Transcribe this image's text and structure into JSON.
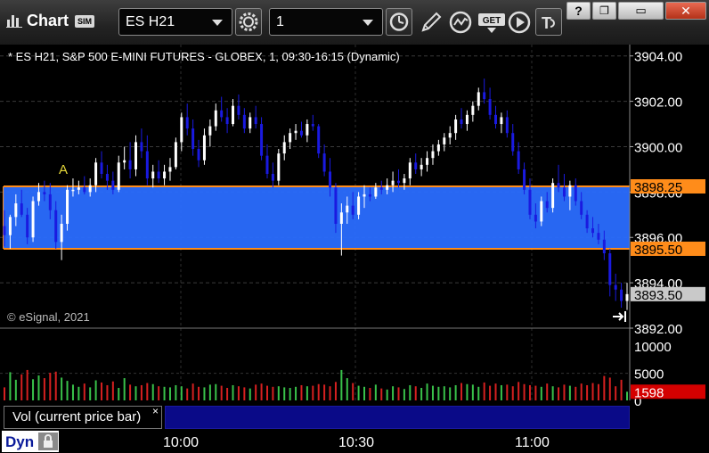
{
  "window": {
    "title": "Chart",
    "mode_badge": "SIM",
    "symbol": "ES H21",
    "interval": "1",
    "controls": {
      "help": "?",
      "restore": "❐",
      "minimize": "▭",
      "close": "✕"
    }
  },
  "toolbar_icons": [
    "settings-gear-icon",
    "clock-icon",
    "pencil-draw-icon",
    "study-wave-icon",
    "get-data-icon",
    "play-icon",
    "text-format-icon"
  ],
  "chart": {
    "title": "* ES H21, S&P 500 E-MINI FUTURES - GLOBEX, 1, 09:30-16:15 (Dynamic)",
    "copyright": "© eSignal, 2021",
    "marker_label": "A",
    "price_ticks": [
      "3904.00",
      "3902.00",
      "3900.00",
      "3898.00",
      "3896.00",
      "3894.00",
      "3892.00"
    ],
    "zone_upper": "3898.25",
    "zone_lower": "3895.50",
    "last_price": "3893.50",
    "volume_ticks": [
      "10000",
      "5000",
      "0"
    ],
    "volume_last": "1598",
    "volume_pane_label": "Vol (current price bar)",
    "volume_pane_close": "×",
    "time_labels": [
      "10:00",
      "10:30",
      "11:00"
    ],
    "status_label": "Dyn",
    "colors": {
      "up_bar": "#ffffff",
      "down_bar": "#1a1ae0",
      "zone_fill": "#2a6dff",
      "zone_line": "#ff8c1a",
      "vol_up": "#39c24a",
      "vol_down": "#d62020",
      "last_price_bg": "#c9c9c9",
      "volume_last_bg": "#d40000"
    }
  },
  "chart_data": {
    "type": "candlestick",
    "title": "* ES H21, S&P 500 E-MINI FUTURES - GLOBEX, 1, 09:30-16:15 (Dynamic)",
    "ylim": [
      3892,
      3904.5
    ],
    "zone": [
      3895.5,
      3898.25
    ],
    "last": 3893.5,
    "volume_ylim": [
      0,
      12000
    ],
    "volume_last": 1598,
    "bars": [
      [
        3896.5,
        3897.2,
        3895.6,
        3896.1
      ],
      [
        3896.1,
        3897.0,
        3895.5,
        3896.9
      ],
      [
        3896.9,
        3897.9,
        3896.5,
        3897.5
      ],
      [
        3897.5,
        3898.1,
        3896.9,
        3897.0
      ],
      [
        3897.0,
        3897.3,
        3895.7,
        3896.0
      ],
      [
        3896.0,
        3897.8,
        3895.8,
        3897.6
      ],
      [
        3897.6,
        3898.4,
        3897.4,
        3898.0
      ],
      [
        3898.0,
        3898.5,
        3897.6,
        3897.9
      ],
      [
        3897.9,
        3898.4,
        3896.8,
        3897.2
      ],
      [
        3897.2,
        3897.6,
        3895.5,
        3895.8
      ],
      [
        3895.8,
        3897.0,
        3895.0,
        3896.6
      ],
      [
        3896.6,
        3898.3,
        3896.3,
        3898.1
      ],
      [
        3898.1,
        3898.6,
        3897.8,
        3898.1
      ],
      [
        3898.1,
        3898.5,
        3897.9,
        3898.2
      ],
      [
        3898.2,
        3898.7,
        3897.9,
        3898.0
      ],
      [
        3898.0,
        3898.6,
        3897.8,
        3898.3
      ],
      [
        3898.3,
        3899.5,
        3898.0,
        3899.3
      ],
      [
        3899.3,
        3899.8,
        3898.6,
        3898.8
      ],
      [
        3898.8,
        3899.2,
        3898.1,
        3898.5
      ],
      [
        3898.5,
        3898.9,
        3897.9,
        3898.1
      ],
      [
        3898.1,
        3899.6,
        3898.0,
        3899.3
      ],
      [
        3899.3,
        3900.0,
        3899.0,
        3899.4
      ],
      [
        3899.4,
        3900.2,
        3898.6,
        3899.0
      ],
      [
        3899.0,
        3900.5,
        3898.7,
        3900.2
      ],
      [
        3900.2,
        3900.8,
        3899.5,
        3899.8
      ],
      [
        3899.8,
        3900.5,
        3898.3,
        3898.6
      ],
      [
        3898.6,
        3899.2,
        3898.2,
        3898.9
      ],
      [
        3898.9,
        3899.4,
        3898.4,
        3898.6
      ],
      [
        3898.6,
        3899.2,
        3898.3,
        3898.9
      ],
      [
        3898.9,
        3899.5,
        3898.5,
        3899.1
      ],
      [
        3899.1,
        3900.4,
        3899.0,
        3900.2
      ],
      [
        3900.2,
        3901.5,
        3899.8,
        3901.3
      ],
      [
        3901.3,
        3901.9,
        3900.5,
        3900.8
      ],
      [
        3900.8,
        3901.2,
        3899.6,
        3899.9
      ],
      [
        3899.9,
        3900.3,
        3899.1,
        3899.4
      ],
      [
        3899.4,
        3900.8,
        3899.2,
        3900.5
      ],
      [
        3900.5,
        3901.2,
        3900.0,
        3900.9
      ],
      [
        3900.9,
        3901.9,
        3900.7,
        3901.6
      ],
      [
        3901.6,
        3902.2,
        3901.1,
        3901.3
      ],
      [
        3901.3,
        3901.7,
        3900.6,
        3901.0
      ],
      [
        3901.0,
        3902.1,
        3900.9,
        3901.8
      ],
      [
        3901.8,
        3902.3,
        3901.2,
        3901.4
      ],
      [
        3901.4,
        3901.7,
        3900.6,
        3900.8
      ],
      [
        3900.8,
        3901.5,
        3900.6,
        3901.3
      ],
      [
        3901.3,
        3901.8,
        3900.8,
        3901.0
      ],
      [
        3901.0,
        3901.3,
        3899.4,
        3899.6
      ],
      [
        3899.6,
        3900.1,
        3898.6,
        3898.8
      ],
      [
        3898.8,
        3899.3,
        3898.2,
        3898.5
      ],
      [
        3898.5,
        3899.9,
        3898.3,
        3899.7
      ],
      [
        3899.7,
        3900.5,
        3899.4,
        3900.2
      ],
      [
        3900.2,
        3900.8,
        3899.9,
        3900.6
      ],
      [
        3900.6,
        3901.0,
        3900.3,
        3900.7
      ],
      [
        3900.7,
        3901.1,
        3900.4,
        3900.5
      ],
      [
        3900.5,
        3901.2,
        3900.2,
        3901.0
      ],
      [
        3901.0,
        3901.4,
        3900.7,
        3900.9
      ],
      [
        3900.9,
        3901.0,
        3899.5,
        3899.7
      ],
      [
        3899.7,
        3900.1,
        3898.7,
        3898.9
      ],
      [
        3898.9,
        3899.5,
        3897.8,
        3898.2
      ],
      [
        3898.2,
        3898.4,
        3896.2,
        3896.6
      ],
      [
        3896.6,
        3897.5,
        3895.2,
        3897.1
      ],
      [
        3897.1,
        3897.8,
        3896.6,
        3897.4
      ],
      [
        3897.4,
        3898.0,
        3896.8,
        3897.0
      ],
      [
        3897.0,
        3898.0,
        3896.8,
        3897.8
      ],
      [
        3897.8,
        3898.3,
        3897.3,
        3897.9
      ],
      [
        3897.9,
        3898.2,
        3897.6,
        3897.8
      ],
      [
        3897.8,
        3898.4,
        3897.7,
        3898.2
      ],
      [
        3898.2,
        3898.5,
        3897.9,
        3898.1
      ],
      [
        3898.1,
        3898.6,
        3897.9,
        3898.3
      ],
      [
        3898.3,
        3898.9,
        3898.0,
        3898.5
      ],
      [
        3898.5,
        3899.0,
        3898.2,
        3898.4
      ],
      [
        3898.4,
        3898.8,
        3898.1,
        3898.6
      ],
      [
        3898.6,
        3899.5,
        3898.3,
        3899.3
      ],
      [
        3899.3,
        3899.7,
        3898.8,
        3899.0
      ],
      [
        3899.0,
        3899.5,
        3898.7,
        3899.2
      ],
      [
        3899.2,
        3899.8,
        3898.9,
        3899.5
      ],
      [
        3899.5,
        3900.1,
        3899.2,
        3899.8
      ],
      [
        3899.8,
        3900.3,
        3899.6,
        3900.1
      ],
      [
        3900.1,
        3900.6,
        3899.8,
        3900.4
      ],
      [
        3900.4,
        3900.9,
        3900.1,
        3900.6
      ],
      [
        3900.6,
        3901.4,
        3900.3,
        3901.2
      ],
      [
        3901.2,
        3901.7,
        3900.8,
        3901.0
      ],
      [
        3901.0,
        3901.6,
        3900.7,
        3901.4
      ],
      [
        3901.4,
        3902.0,
        3901.1,
        3901.8
      ],
      [
        3901.8,
        3902.6,
        3901.6,
        3902.4
      ],
      [
        3902.4,
        3903.0,
        3901.9,
        3902.1
      ],
      [
        3902.1,
        3902.6,
        3901.2,
        3901.4
      ],
      [
        3901.4,
        3901.8,
        3900.8,
        3901.0
      ],
      [
        3901.0,
        3901.5,
        3900.6,
        3901.3
      ],
      [
        3901.3,
        3901.6,
        3900.4,
        3900.6
      ],
      [
        3900.6,
        3901.0,
        3899.6,
        3899.8
      ],
      [
        3899.8,
        3900.2,
        3898.8,
        3899.0
      ],
      [
        3899.0,
        3899.3,
        3897.9,
        3898.1
      ],
      [
        3898.1,
        3898.6,
        3896.8,
        3897.0
      ],
      [
        3897.0,
        3897.5,
        3896.4,
        3896.7
      ],
      [
        3896.7,
        3897.8,
        3896.5,
        3897.6
      ],
      [
        3897.6,
        3898.0,
        3897.1,
        3897.3
      ],
      [
        3897.3,
        3898.6,
        3897.1,
        3898.4
      ],
      [
        3898.4,
        3899.2,
        3898.0,
        3898.2
      ],
      [
        3898.2,
        3898.8,
        3897.6,
        3897.8
      ],
      [
        3897.8,
        3898.5,
        3897.2,
        3898.3
      ],
      [
        3898.3,
        3898.6,
        3897.4,
        3897.6
      ],
      [
        3897.6,
        3898.0,
        3896.8,
        3897.0
      ],
      [
        3897.0,
        3897.2,
        3896.2,
        3896.4
      ],
      [
        3896.4,
        3896.9,
        3896.0,
        3896.2
      ],
      [
        3896.2,
        3896.6,
        3895.7,
        3895.9
      ],
      [
        3895.9,
        3896.3,
        3895.0,
        3895.3
      ],
      [
        3895.3,
        3895.5,
        3893.4,
        3893.9
      ],
      [
        3893.9,
        3894.4,
        3893.2,
        3893.7
      ],
      [
        3893.7,
        3894.0,
        3892.9,
        3893.2
      ],
      [
        3893.2,
        3894.0,
        3892.8,
        3893.5
      ]
    ],
    "volume": [
      2400,
      5200,
      3800,
      4800,
      5600,
      3900,
      4600,
      4100,
      5100,
      5300,
      4200,
      3600,
      2900,
      2500,
      3100,
      2400,
      3700,
      3300,
      2800,
      3500,
      2300,
      4100,
      2900,
      2600,
      2800,
      3200,
      3000,
      2600,
      2500,
      2400,
      2800,
      2600,
      2200,
      3100,
      2500,
      2400,
      2900,
      3000,
      2700,
      2300,
      2800,
      2600,
      2400,
      2200,
      2900,
      3100,
      2700,
      2500,
      2600,
      2400,
      2300,
      2500,
      2800,
      2600,
      2700,
      3000,
      2900,
      2600,
      3400,
      5600,
      4100,
      3200,
      2700,
      2500,
      2300,
      2900,
      2200,
      2000,
      2600,
      2400,
      2100,
      2800,
      2600,
      2300,
      3100,
      2700,
      2500,
      2600,
      2400,
      2800,
      3200,
      3000,
      2900,
      2500,
      3300,
      2700,
      3100,
      2800,
      2900,
      2600,
      3400,
      3000,
      2800,
      2700,
      2500,
      3100,
      2600,
      2400,
      2900,
      2700,
      2500,
      3100,
      2800,
      3200,
      3000,
      4500,
      4200,
      2600,
      3800,
      1598
    ]
  }
}
